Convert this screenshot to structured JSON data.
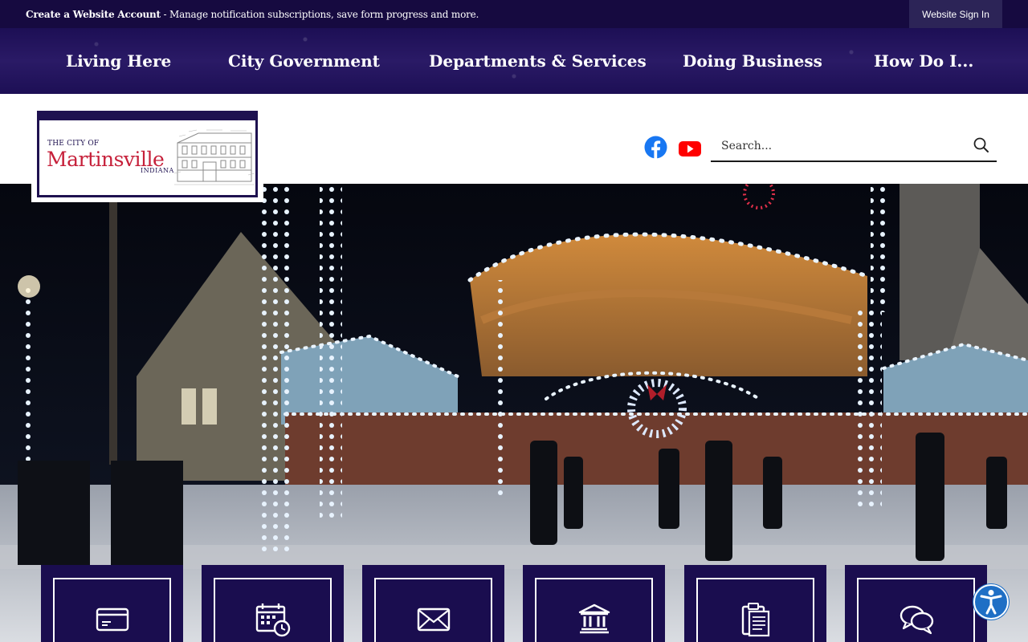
{
  "topbar": {
    "account_link": "Create a Website Account",
    "account_desc": " - Manage notification subscriptions, save form progress and more.",
    "signin_label": "Website Sign In"
  },
  "nav": {
    "items": [
      {
        "label": "Living Here"
      },
      {
        "label": "City Government"
      },
      {
        "label": "Departments & Services"
      },
      {
        "label": "Doing Business"
      },
      {
        "label": "How Do I..."
      }
    ]
  },
  "logo": {
    "the_city_of": "THE CITY OF",
    "name": "Martinsville",
    "state": "INDIANA"
  },
  "social": {
    "facebook_icon": "facebook-icon",
    "youtube_icon": "youtube-icon"
  },
  "search": {
    "placeholder": "Search...",
    "icon": "search-icon"
  },
  "quick_links": [
    {
      "icon": "credit-card-icon"
    },
    {
      "icon": "calendar-clock-icon"
    },
    {
      "icon": "envelope-icon"
    },
    {
      "icon": "government-building-icon"
    },
    {
      "icon": "clipboard-document-icon"
    },
    {
      "icon": "chat-bubbles-icon"
    }
  ],
  "accessibility": {
    "icon": "accessibility-icon"
  },
  "colors": {
    "brand_navy": "#1a0d4f",
    "brand_red": "#c6203a",
    "facebook_blue": "#1877f2",
    "youtube_red": "#ff0000",
    "accessibility_blue": "#1f6fc5"
  }
}
